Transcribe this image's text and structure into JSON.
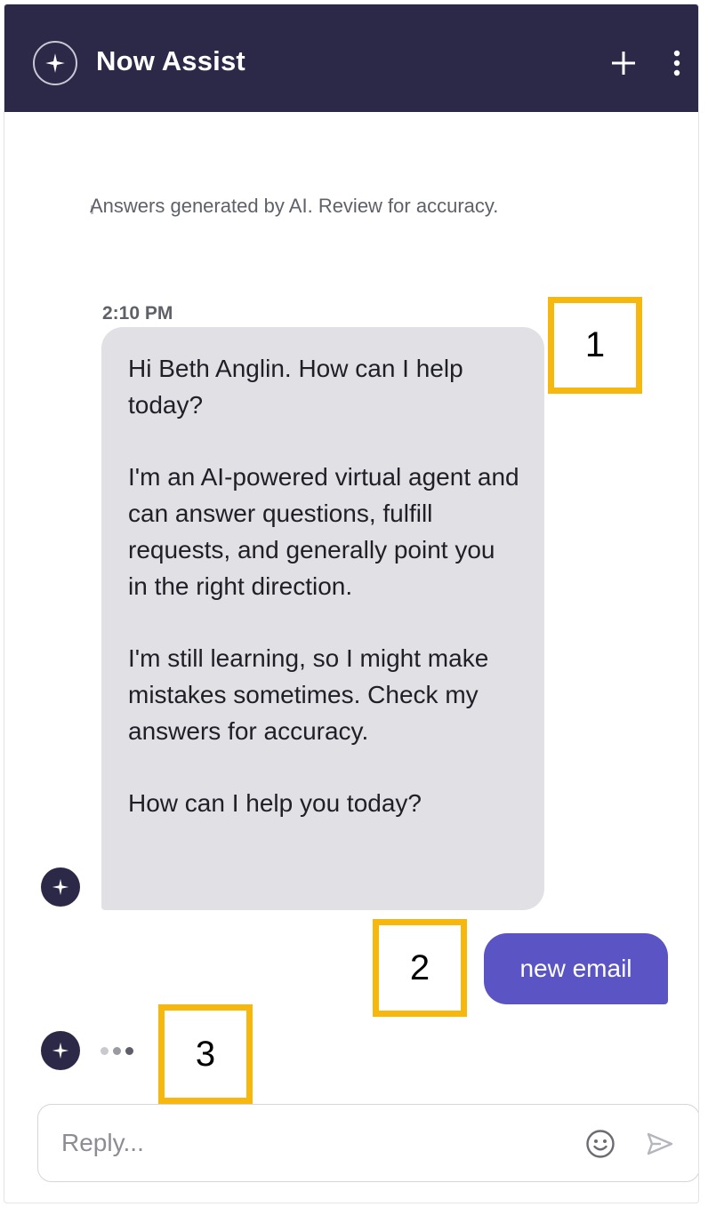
{
  "header": {
    "title": "Now Assist",
    "brand_icon": "sparkle-icon",
    "new_chat_icon": "plus-icon",
    "menu_icon": "more-vertical-icon",
    "background_color": "#2b2947"
  },
  "disclaimer": {
    "text": "Answers generated by AI. Review for accuracy."
  },
  "conversation": {
    "bot_message": {
      "timestamp": "2:10 PM",
      "paragraphs": [
        "Hi Beth Anglin. How can I help today?",
        "I'm an AI-powered virtual agent and can answer questions, fulfill requests, and generally point you in the right direction.",
        "I'm still learning, so I might make mistakes sometimes. Check my answers for accuracy.",
        "How can I help you today?"
      ],
      "bubble_color": "#e1e0e5"
    },
    "user_message": {
      "text": "new email",
      "bubble_color": "#5a54c4"
    },
    "typing_indicator": {
      "dot_count": 3
    }
  },
  "callouts": [
    {
      "label": "1"
    },
    {
      "label": "2"
    },
    {
      "label": "3"
    }
  ],
  "callout_color": "#f6b70e",
  "composer": {
    "placeholder": "Reply...",
    "emoji_icon": "smiley-icon",
    "send_icon": "send-arrow-icon"
  }
}
